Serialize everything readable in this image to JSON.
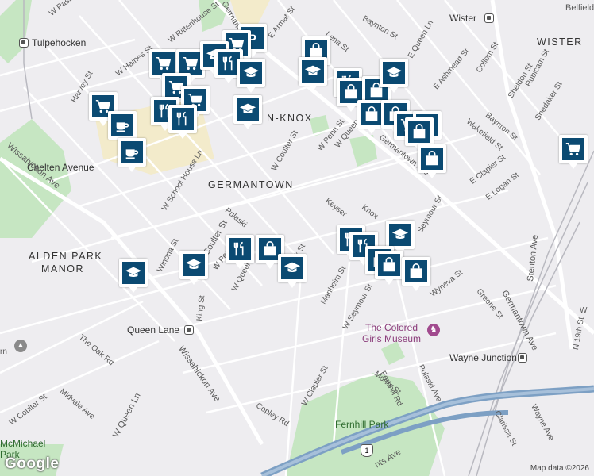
{
  "map": {
    "neighborhoods": [
      "GERMANTOWN",
      "ALDEN PARK",
      "MANOR",
      "WISTER",
      "N-KNOX"
    ],
    "transit": [
      "Tulpehocken",
      "Chelten Avenue",
      "Queen Lane",
      "Wayne Junction",
      "Wister"
    ],
    "poi": {
      "museum_line1": "The Colored",
      "museum_line2": "Girls Museum",
      "park": "Fernhill Park",
      "park2_line1": "McMichael",
      "park2_line2": "Park",
      "route_shield": "1"
    },
    "streets": {
      "w_pastorius": "W Pastorius",
      "w_rittenhouse": "W Rittenhouse St",
      "germantown_ave_top": "Germantown Ave",
      "e_armat": "E Armat St",
      "baynton_top": "Baynton St",
      "lena": "Lena St",
      "e_queen_ln": "E Queen Ln",
      "e_ashmead": "E Ashmead St",
      "collom": "Collom St",
      "rubicam": "Rubicam St",
      "belfield": "Belfield",
      "w_haines": "W Haines St",
      "harvey": "Harvey St",
      "sheldon": "Sheldon St",
      "shedaker": "Shedaker St",
      "baynton_mid": "Baynton St",
      "wakefield": "Wakefield St",
      "w_penn_top": "W Penn St",
      "w_queen_ln_top": "W Queen Ln",
      "w_coulter_top": "W Coulter St",
      "germantown_ave_mid": "Germantown Ave",
      "e_clapier": "E Clapier St",
      "e_logan": "E Logan St",
      "wissahickon_top": "Wissahickon Ave",
      "w_school_house": "W School House Ln",
      "coulter_mid": "Coulter St",
      "pulaski_mid": "Pulaski",
      "w_penn_mid": "W Penn St",
      "w_queen_mid": "W Queen",
      "hancock": "Hancock St",
      "keyser": "Keyser",
      "knox": "Knox",
      "seymour_right": "Seymour St",
      "winona": "Winona St",
      "stenton": "Stenton Ave",
      "germantown_ave_right": "Germantown Ave",
      "wyneva": "Wyneva St",
      "greene": "Greene St",
      "manheim": "Manheim St",
      "w_seymour": "W Seymour St",
      "king": "King St",
      "the_oak": "The Oak Rd",
      "wissahickon_bottom": "Wissahickon Ave",
      "fernhill_rd": "Fernhill Rd",
      "pulaski_ave": "Pulaski Ave",
      "morris": "Morris St",
      "midvale": "Midvale Ave",
      "w_coulter_bottom": "W Coulter St",
      "w_queen_ln_bottom": "W Queen Ln",
      "copley": "Copley Rd",
      "w_clapier": "W Clapier St",
      "clarissa": "Clarissa St",
      "wayne_ave": "Wayne Ave",
      "n_19th": "N 19th St",
      "w_short": "W",
      "nts_ave": "nts Ave",
      "rn_partial": "rn"
    },
    "attribution": "Map data ©2026",
    "logo": "Google"
  },
  "icons": [
    "shopping-cart-icon",
    "restaurant-icon",
    "cafe-icon",
    "school-icon",
    "shopping-bag-icon",
    "parking-icon",
    "transit-station-icon",
    "museum-icon"
  ],
  "colors": {
    "pin": "#0b4a72",
    "park": "#b7dfb4",
    "highway": "#7da0c4",
    "background": "#eeedf0",
    "commercial": "#f3e9c6"
  }
}
